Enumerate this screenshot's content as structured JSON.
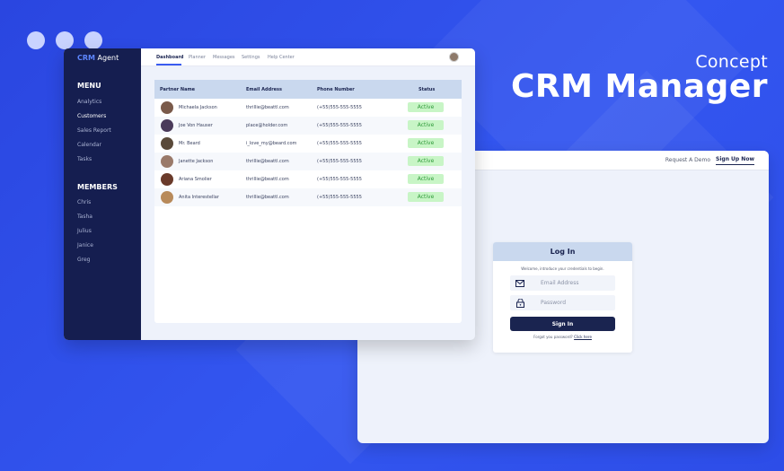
{
  "hero": {
    "subtitle": "Concept",
    "title": "CRM Manager"
  },
  "crm": {
    "brand_primary": "CRM",
    "brand_secondary": " Agent",
    "menu_heading": "MENU",
    "menu_items": [
      "Analytics",
      "Customers",
      "Sales Report",
      "Calendar",
      "Tasks"
    ],
    "active_menu": "Customers",
    "members_heading": "MEMBERS",
    "members": [
      "Chris",
      "Tasha",
      "Julius",
      "Janice",
      "Greg"
    ],
    "nav": [
      "Dashboard",
      "Planner",
      "Messages",
      "Settings",
      "Help Center"
    ],
    "active_nav": "Dashboard",
    "table": {
      "headers": [
        "Partner Name",
        "Email Address",
        "Phone Number",
        "Status"
      ],
      "rows": [
        {
          "name": "Michaela Jackson",
          "email": "thrillie@beattl.com",
          "phone": "(+55)555-555-5555",
          "status": "Active"
        },
        {
          "name": "Joe Von Hauser",
          "email": "place@holder.com",
          "phone": "(+55)555-555-5555",
          "status": "Active"
        },
        {
          "name": "Mr. Beard",
          "email": "i_love_my@beard.com",
          "phone": "(+55)555-555-5555",
          "status": "Active"
        },
        {
          "name": "Janette Jackson",
          "email": "thrillie@beattl.com",
          "phone": "(+55)555-555-5555",
          "status": "Active"
        },
        {
          "name": "Ariana Smolier",
          "email": "thrillie@beattl.com",
          "phone": "(+55)555-555-5555",
          "status": "Active"
        },
        {
          "name": "Anita Interestellar",
          "email": "thrillie@beattl.com",
          "phone": "(+55)555-555-5555",
          "status": "Active"
        }
      ]
    }
  },
  "login": {
    "topbar_request": "Request A Demo",
    "topbar_signup": "Sign Up Now",
    "title": "Log In",
    "welcome": "Welcome, introduce your credentials to begin.",
    "email_placeholder": "Email Address",
    "password_placeholder": "Password",
    "signin_label": "Sign In",
    "forgot_text": "Forgot you password?",
    "forgot_link": "Click here"
  },
  "colors": {
    "background": "#2f4fe6",
    "sidebar": "#151e50",
    "brand_accent": "#5d86ff",
    "table_header": "#c9d8ee",
    "status_bg": "#c8f5c6",
    "status_text": "#2f9a3a",
    "button": "#1a2450"
  },
  "icons": {
    "email": "envelope-icon",
    "password": "lock-icon"
  }
}
